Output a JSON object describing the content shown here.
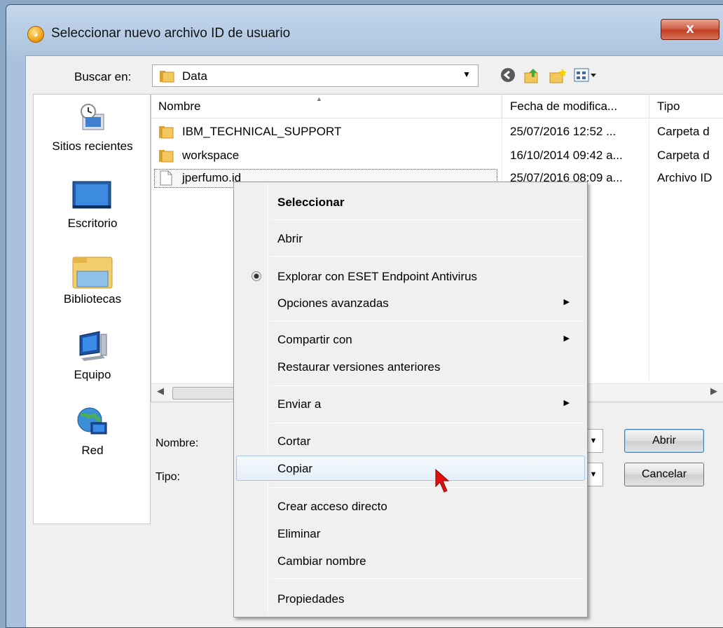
{
  "window": {
    "title": "Seleccionar nuevo archivo ID de usuario",
    "close_label": "x"
  },
  "toolbar": {
    "look_in_label": "Buscar en:",
    "look_in_value": "Data",
    "icons": [
      "back-icon",
      "up-folder-icon",
      "new-folder-icon",
      "view-menu-icon"
    ]
  },
  "places": [
    {
      "label": "Sitios recientes",
      "icon": "recent-places-icon"
    },
    {
      "label": "Escritorio",
      "icon": "desktop-icon"
    },
    {
      "label": "Bibliotecas",
      "icon": "libraries-icon"
    },
    {
      "label": "Equipo",
      "icon": "computer-icon"
    },
    {
      "label": "Red",
      "icon": "network-icon"
    }
  ],
  "file_list": {
    "columns": [
      "Nombre",
      "Fecha de modifica...",
      "Tipo"
    ],
    "rows": [
      {
        "name": "IBM_TECHNICAL_SUPPORT",
        "date": "25/07/2016 12:52 ...",
        "type": "Carpeta d",
        "icon": "folder-icon"
      },
      {
        "name": "workspace",
        "date": "16/10/2014 09:42 a...",
        "type": "Carpeta d",
        "icon": "folder-icon"
      },
      {
        "name": "jperfumo.id",
        "date": "25/07/2016 08:09 a...",
        "type": "Archivo ID",
        "icon": "file-icon"
      }
    ]
  },
  "form": {
    "name_label": "Nombre:",
    "type_label": "Tipo:"
  },
  "buttons": {
    "open": "Abrir",
    "cancel": "Cancelar"
  },
  "context_menu": {
    "items": [
      {
        "label": "Seleccionar",
        "bold": true
      },
      {
        "label": "Abrir"
      },
      {
        "label": "Explorar con ESET Endpoint Antivirus",
        "icon": "eset-icon"
      },
      {
        "label": "Opciones avanzadas",
        "submenu": true
      },
      {
        "label": "Compartir con",
        "submenu": true
      },
      {
        "label": "Restaurar versiones anteriores"
      },
      {
        "label": "Enviar a",
        "submenu": true
      },
      {
        "label": "Cortar"
      },
      {
        "label": "Copiar",
        "highlighted": true
      },
      {
        "label": "Crear acceso directo"
      },
      {
        "label": "Eliminar"
      },
      {
        "label": "Cambiar nombre"
      },
      {
        "label": "Propiedades"
      }
    ]
  },
  "colors": {
    "window_frame": "#a9c1dc",
    "close_button": "#c33d22",
    "menu_highlight": "#e4eef9",
    "cursor": "#e01010"
  }
}
